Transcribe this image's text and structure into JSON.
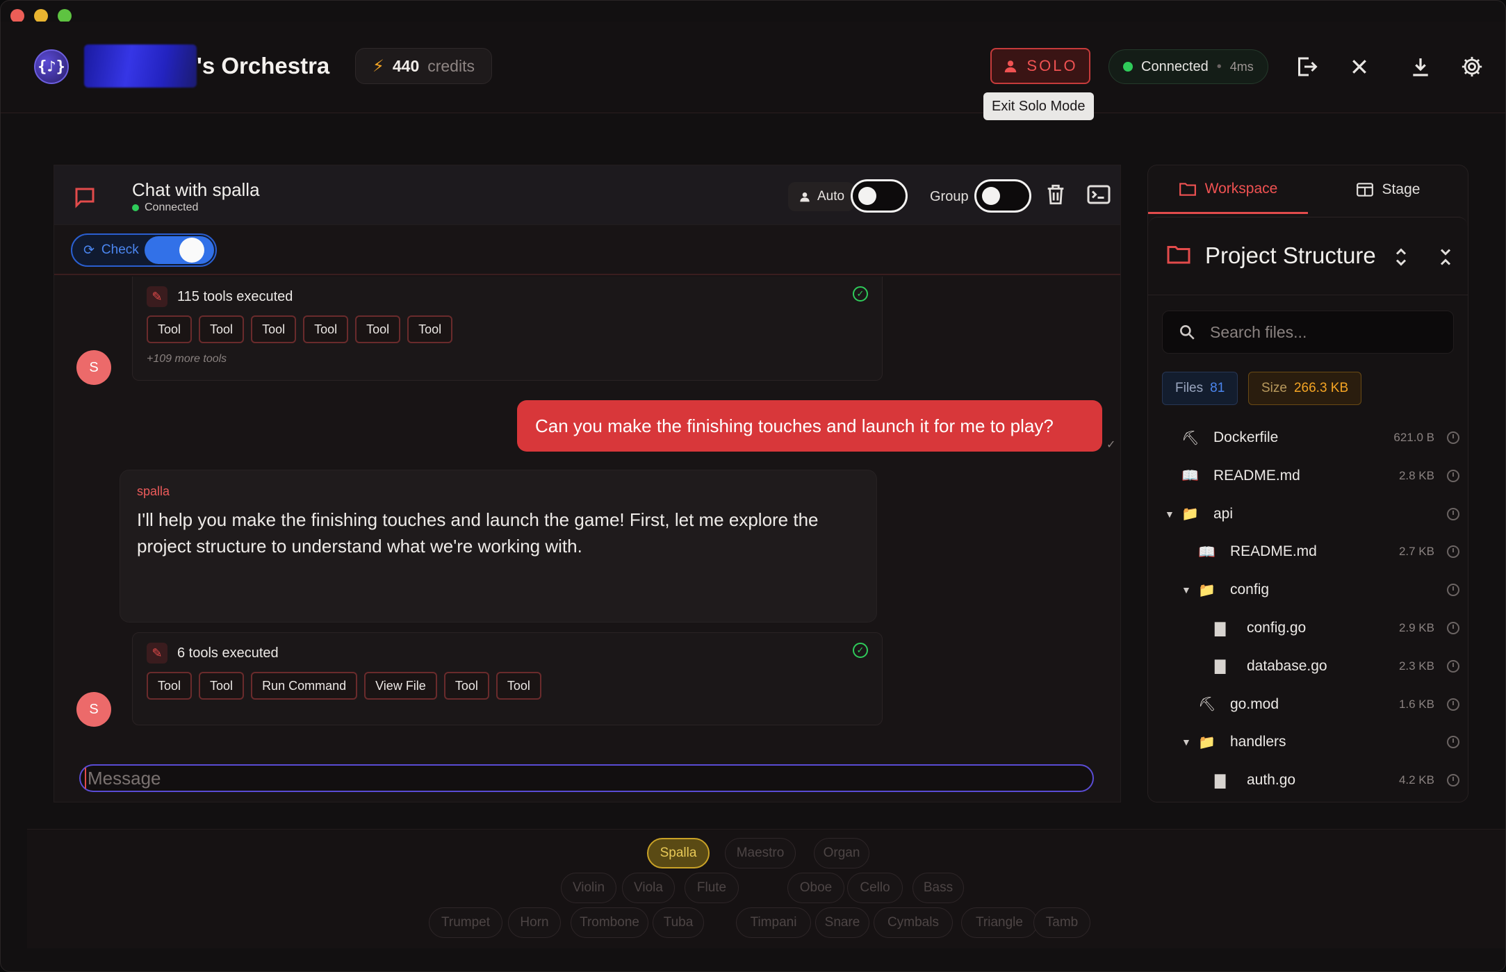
{
  "header": {
    "logo_glyph": "{♪}",
    "title_suffix": "'s Orchestra",
    "credits": {
      "value": "440",
      "label": "credits"
    },
    "solo_label": "SOLO",
    "tooltip": "Exit Solo Mode",
    "connection": {
      "status": "Connected",
      "separator": "•",
      "latency": "4ms"
    }
  },
  "chat": {
    "title": "Chat with spalla",
    "status": "Connected",
    "auto_label": "Auto",
    "group_label": "Group",
    "check_label": "Check",
    "tools_1": {
      "count_label": "115 tools executed",
      "chips": [
        "Tool",
        "Tool",
        "Tool",
        "Tool",
        "Tool",
        "Tool"
      ],
      "more": "+109 more tools"
    },
    "avatar_letter": "S",
    "user_message": "Can you make the finishing touches and launch it for me to play?",
    "sent_check": "✓",
    "assistant": {
      "name": "spalla",
      "text": "I'll help you make the finishing touches and launch the game! First, let me explore the project structure to understand what we're working with."
    },
    "tools_2": {
      "count_label": "6 tools executed",
      "chips": [
        "Tool",
        "Tool",
        "Run Command",
        "View File",
        "Tool",
        "Tool"
      ]
    },
    "input_placeholder": "Message"
  },
  "sidebar": {
    "tabs": {
      "workspace": "Workspace",
      "stage": "Stage"
    },
    "title": "Project Structure",
    "search_placeholder": "Search files...",
    "files_label": "Files",
    "files_value": "81",
    "size_label": "Size",
    "size_value": "266.3 KB",
    "tree": [
      {
        "name": "Dockerfile",
        "size": "621.0 B",
        "icon": "hammer-icon",
        "glyph": "⛏",
        "depth": 0,
        "folder": false
      },
      {
        "name": "README.md",
        "size": "2.8 KB",
        "icon": "book-icon",
        "glyph": "📖",
        "depth": 0,
        "folder": false
      },
      {
        "name": "api",
        "size": "",
        "icon": "folder-icon",
        "glyph": "📁",
        "depth": 0,
        "folder": true
      },
      {
        "name": "README.md",
        "size": "2.7 KB",
        "icon": "book-icon",
        "glyph": "📖",
        "depth": 1,
        "folder": false
      },
      {
        "name": "config",
        "size": "",
        "icon": "folder-icon",
        "glyph": "📁",
        "depth": 1,
        "folder": true
      },
      {
        "name": "config.go",
        "size": "2.9 KB",
        "icon": "file-icon",
        "glyph": "▇",
        "depth": 2,
        "folder": false
      },
      {
        "name": "database.go",
        "size": "2.3 KB",
        "icon": "file-icon",
        "glyph": "▇",
        "depth": 2,
        "folder": false
      },
      {
        "name": "go.mod",
        "size": "1.6 KB",
        "icon": "hammer-icon",
        "glyph": "⛏",
        "depth": 1,
        "folder": false
      },
      {
        "name": "handlers",
        "size": "",
        "icon": "folder-icon",
        "glyph": "📁",
        "depth": 1,
        "folder": true
      },
      {
        "name": "auth.go",
        "size": "4.2 KB",
        "icon": "file-icon",
        "glyph": "▇",
        "depth": 2,
        "folder": false
      }
    ]
  },
  "instruments": {
    "row1": [
      "Spalla",
      "Maestro",
      "Organ"
    ],
    "row2": [
      "Violin",
      "Viola",
      "Flute",
      "Oboe",
      "Cello",
      "Bass"
    ],
    "row3": [
      "Trumpet",
      "Horn",
      "Trombone",
      "Tuba",
      "Timpani",
      "Snare",
      "Cymbals",
      "Triangle",
      "Tamb"
    ],
    "active": "Spalla"
  },
  "colors": {
    "accent_red": "#e24b4b",
    "connected_green": "#2fcb5a",
    "check_blue": "#3271e8",
    "active_gold": "#c9a227"
  }
}
